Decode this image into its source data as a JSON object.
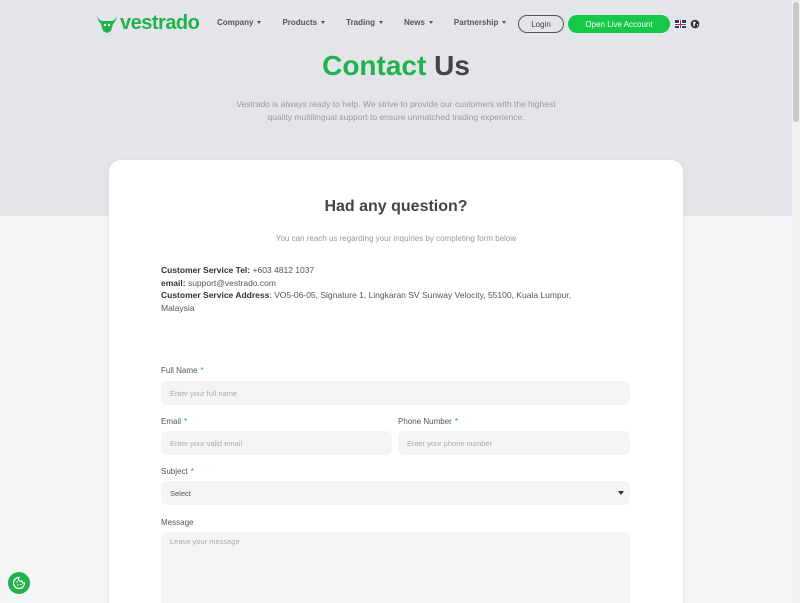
{
  "header": {
    "logo_text": "vestrado",
    "nav": [
      {
        "label": "Company"
      },
      {
        "label": "Products"
      },
      {
        "label": "Trading"
      },
      {
        "label": "News"
      },
      {
        "label": "Partnership"
      }
    ],
    "login_label": "Login",
    "open_account_label": "Open Live Account",
    "language_icon": "uk-flag-icon",
    "globe_icon": "globe-icon"
  },
  "hero": {
    "title_green": "Contact",
    "title_dark": " Us",
    "subtitle_line1": "Vestrado is always ready to help. We strive to provide our customers with the highest",
    "subtitle_line2": "quality multilingual support to ensure unmatched trading experience."
  },
  "card": {
    "heading": "Had any question?",
    "hint": "You can reach us regarding your inquiries by completing form below",
    "tel_label": "Customer Service Tel:",
    "tel_value": " +603 4812 1037",
    "email_label": "email:",
    "email_value": " support@vestrado.com",
    "address_label": "Customer Service Address",
    "address_value": ": VO5-06-05, Signature 1, Lingkaran SV Sunway Velocity, 55100, Kuala Lumpur,",
    "address_value2": "Malaysia"
  },
  "form": {
    "full_name_label": "Full Name",
    "full_name_placeholder": "Enter your full name",
    "email_label": "Email",
    "email_placeholder": "Enter your valid email",
    "phone_label": "Phone Number",
    "phone_placeholder": "Enter your phone number",
    "subject_label": "Subject",
    "subject_value": "Select",
    "message_label": "Message",
    "message_placeholder": "Leave your message",
    "required_mark": "*"
  },
  "colors": {
    "accent": "#22b24c",
    "button_green": "#16c848"
  }
}
